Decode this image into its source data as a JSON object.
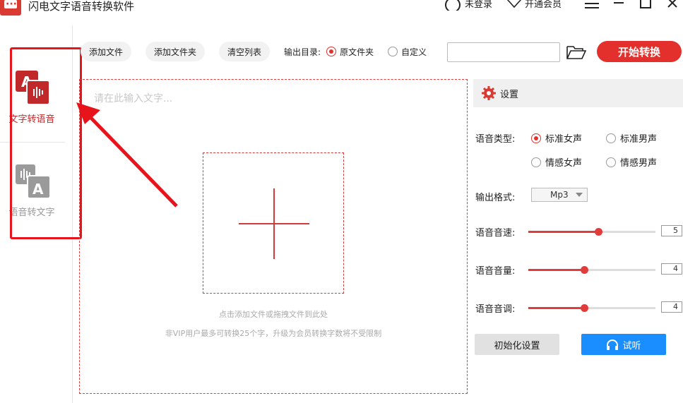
{
  "app": {
    "title": "闪电文字语音转换软件",
    "login": "未登录",
    "vip": "开通会员",
    "brand_color": "#e4302c"
  },
  "sidebar": {
    "items": [
      {
        "label": "文字转语音",
        "icon": "text-to-speech-icon",
        "active": true
      },
      {
        "label": "语音转文字",
        "icon": "speech-to-text-icon",
        "active": false
      }
    ]
  },
  "toolbar": {
    "add_file": "添加文件",
    "add_folder": "添加文件夹",
    "clear_list": "清空列表",
    "output_dir_label": "输出目录:",
    "option_source_folder": "原文件夹",
    "option_custom": "自定义",
    "selected_output": "原文件夹",
    "path_value": "",
    "start_label": "开始转换"
  },
  "editor": {
    "placeholder": "请在此输入文字...",
    "drop_hint": "点击添加文件或拖拽文件到此处",
    "limit_hint": "非VIP用户最多可转换25个字，升级为会员转换字数将不受限制"
  },
  "settings": {
    "title": "设置",
    "voice_type_label": "语音类型:",
    "voice_options": [
      "标准女声",
      "标准男声",
      "情感女声",
      "情感男声"
    ],
    "voice_selected": "标准女声",
    "format_label": "输出格式:",
    "format_value": "Mp3",
    "speed_label": "语音音速:",
    "speed_value": "5",
    "speed_fraction": 0.55,
    "volume_label": "语音音量:",
    "volume_value": "4",
    "volume_fraction": 0.44,
    "pitch_label": "语音音调:",
    "pitch_value": "4",
    "pitch_fraction": 0.44,
    "reset_label": "初始化设置",
    "listen_label": "试听"
  }
}
